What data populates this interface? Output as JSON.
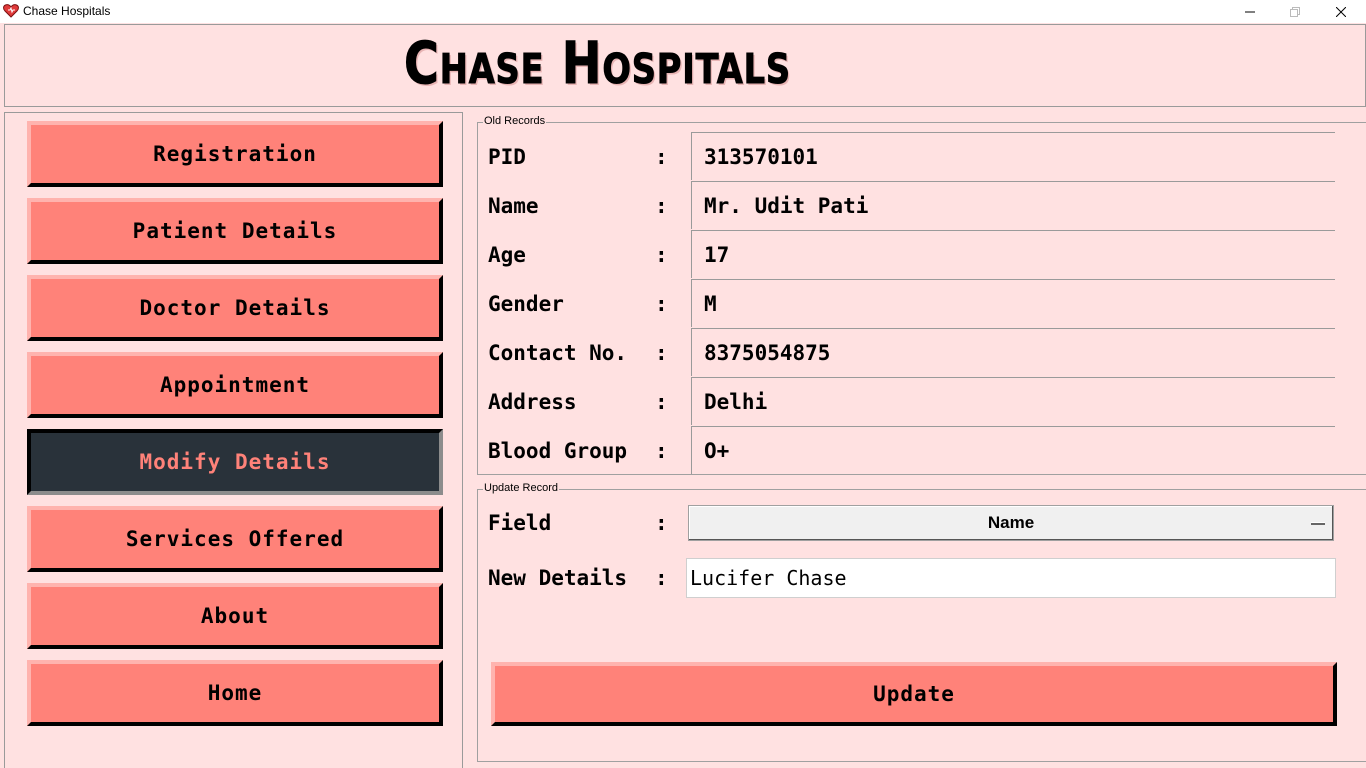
{
  "window": {
    "title": "Chase Hospitals"
  },
  "header": {
    "title": "Chase Hospitals"
  },
  "sidebar": {
    "items": [
      {
        "label": "Registration"
      },
      {
        "label": "Patient Details"
      },
      {
        "label": "Doctor Details"
      },
      {
        "label": "Appointment"
      },
      {
        "label": "Modify Details",
        "active": true
      },
      {
        "label": "Services Offered"
      },
      {
        "label": "About"
      },
      {
        "label": "Home"
      }
    ]
  },
  "old_records": {
    "group_label": "Old Records",
    "colon": ":",
    "rows": [
      {
        "label": "PID",
        "value": "313570101"
      },
      {
        "label": "Name",
        "value": "Mr. Udit Pati"
      },
      {
        "label": "Age",
        "value": "17"
      },
      {
        "label": "Gender",
        "value": "M"
      },
      {
        "label": "Contact No.",
        "value": "8375054875"
      },
      {
        "label": "Address",
        "value": "Delhi"
      },
      {
        "label": "Blood Group",
        "value": "O+"
      }
    ]
  },
  "update_record": {
    "group_label": "Update Record",
    "colon": ":",
    "field_label": "Field",
    "field_value": "Name",
    "new_details_label": "New Details",
    "new_details_value": "Lucifer Chase",
    "update_button": "Update"
  },
  "colors": {
    "background": "#ffe1e1",
    "button": "#ff8279",
    "active_button": "#29323a"
  }
}
